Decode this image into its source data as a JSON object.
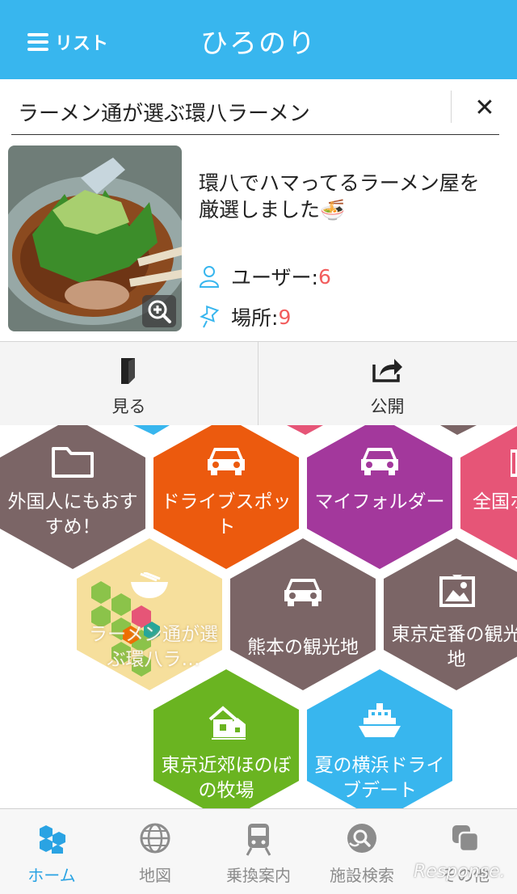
{
  "header": {
    "list_label": "リスト",
    "app_title": "ひろのり"
  },
  "card": {
    "title": "ラーメン通が選ぶ環八ラーメン",
    "description": "環八でハマってるラーメン屋を厳選しました🍜",
    "users_label": "ユーザー:",
    "users_count": "6",
    "places_label": "場所:",
    "places_count": "9"
  },
  "actions": {
    "view_label": "見る",
    "publish_label": "公開"
  },
  "tiles": [
    {
      "label": "外国人にもおすすめ！",
      "color": "#7b6566",
      "icon": "folder-icon"
    },
    {
      "label": "ドライブスポット",
      "color": "#ec5a0e",
      "icon": "car-icon"
    },
    {
      "label": "マイフォルダー",
      "color": "#a3389c",
      "icon": "car-icon"
    },
    {
      "label": "全国ホ",
      "color": "#e65577",
      "icon": "folder-icon"
    },
    {
      "label": "ラーメン通が選ぶ環八ラ…",
      "color": "#f6df9c",
      "icon": "ramen-collage-icon"
    },
    {
      "label": "熊本の観光地",
      "color": "#7b6566",
      "icon": "car-icon"
    },
    {
      "label": "東京定番の観光地",
      "color": "#7b6566",
      "icon": "image-icon"
    },
    {
      "label": "東京近郊ほのぼの牧場",
      "color": "#6ab421",
      "icon": "house-icon"
    },
    {
      "label": "夏の横浜ドライブデート",
      "color": "#38b6ee",
      "icon": "ship-icon"
    }
  ],
  "tabs": [
    {
      "label": "ホーム",
      "icon": "hexagons-icon",
      "active": true
    },
    {
      "label": "地図",
      "icon": "globe-icon",
      "active": false
    },
    {
      "label": "乗換案内",
      "icon": "train-icon",
      "active": false
    },
    {
      "label": "施設検索",
      "icon": "search-pin-icon",
      "active": false
    },
    {
      "label": "その他",
      "icon": "stack-icon",
      "active": false
    }
  ],
  "watermark": "Response."
}
